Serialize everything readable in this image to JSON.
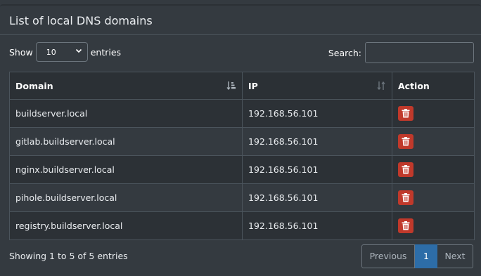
{
  "card": {
    "title": "List of local DNS domains"
  },
  "length": {
    "show_label": "Show",
    "selected": "10",
    "entries_label": "entries"
  },
  "search": {
    "label": "Search:",
    "value": "",
    "placeholder": ""
  },
  "table": {
    "columns": [
      "Domain",
      "IP",
      "Action"
    ],
    "rows": [
      {
        "domain": "buildserver.local",
        "ip": "192.168.56.101"
      },
      {
        "domain": "gitlab.buildserver.local",
        "ip": "192.168.56.101"
      },
      {
        "domain": "nginx.buildserver.local",
        "ip": "192.168.56.101"
      },
      {
        "domain": "pihole.buildserver.local",
        "ip": "192.168.56.101"
      },
      {
        "domain": "registry.buildserver.local",
        "ip": "192.168.56.101"
      }
    ],
    "action_icon": "trash-icon"
  },
  "footer": {
    "info": "Showing 1 to 5 of 5 entries",
    "previous": "Previous",
    "current_page": "1",
    "next": "Next"
  },
  "colors": {
    "accent": "#2d6da8",
    "danger": "#c0392b",
    "background": "#343a40"
  }
}
